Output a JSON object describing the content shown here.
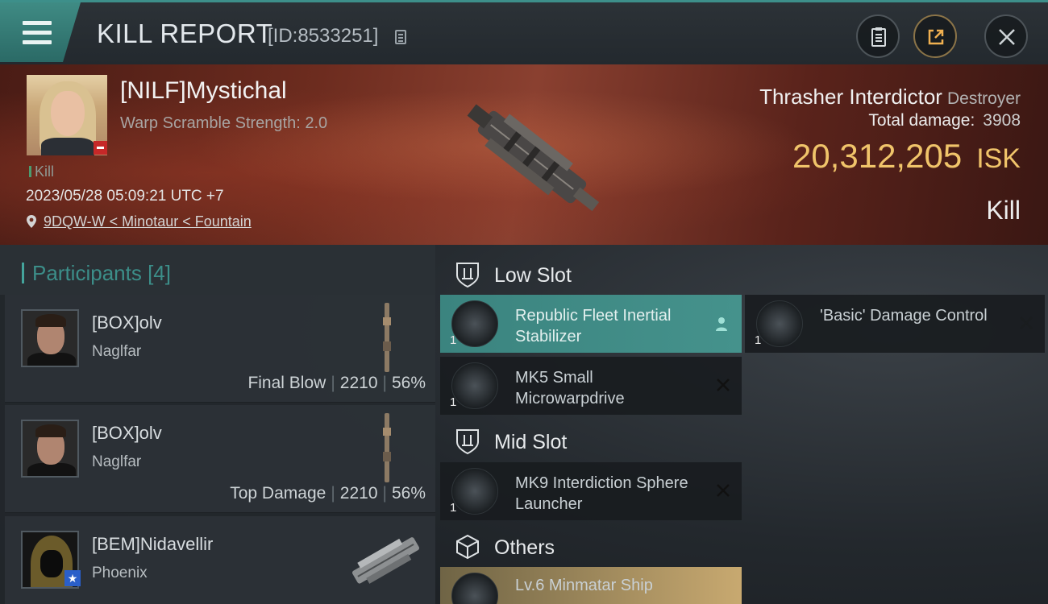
{
  "header": {
    "title": "KILL REPORT",
    "report_id": "[ID:8533251]"
  },
  "victim": {
    "name": "[NILF]Mystichal",
    "subtitle": "Warp Scramble Strength: 2.0",
    "status": "Kill",
    "datetime": "2023/05/28 05:09:21 UTC +7",
    "location": "9DQW-W < Minotaur < Fountain",
    "ship_name": "Thrasher Interdictor",
    "ship_class": "Destroyer",
    "total_damage_label": "Total damage:",
    "total_damage": "3908",
    "isk_value": "20,312,205",
    "isk_unit": "ISK",
    "result": "Kill"
  },
  "participants": {
    "label": "Participants",
    "count": "[4]",
    "rows": [
      {
        "name": "[BOX]olv",
        "ship": "Naglfar",
        "role": "Final Blow",
        "damage": "2210",
        "percent": "56%"
      },
      {
        "name": "[BOX]olv",
        "ship": "Naglfar",
        "role": "Top Damage",
        "damage": "2210",
        "percent": "56%"
      },
      {
        "name": "[BEM]Nidavellir",
        "ship": "Phoenix",
        "role": "",
        "damage": "",
        "percent": ""
      }
    ]
  },
  "fittings": {
    "low_slot_label": "Low Slot",
    "mid_slot_label": "Mid Slot",
    "others_label": "Others",
    "modules": [
      {
        "name": "Republic Fleet Inertial Stabilizer",
        "qty": "1"
      },
      {
        "name": "'Basic' Damage Control",
        "qty": "1"
      },
      {
        "name": "MK5 Small Microwarpdrive",
        "qty": "1"
      },
      {
        "name": "MK9 Interdiction Sphere Launcher",
        "qty": "1"
      },
      {
        "name": "Lv.6 Minmatar Ship",
        "qty": ""
      }
    ]
  },
  "colors": {
    "accent": "#44a49c",
    "isk": "#f0c46a",
    "highlight_row": "#3b847f"
  }
}
